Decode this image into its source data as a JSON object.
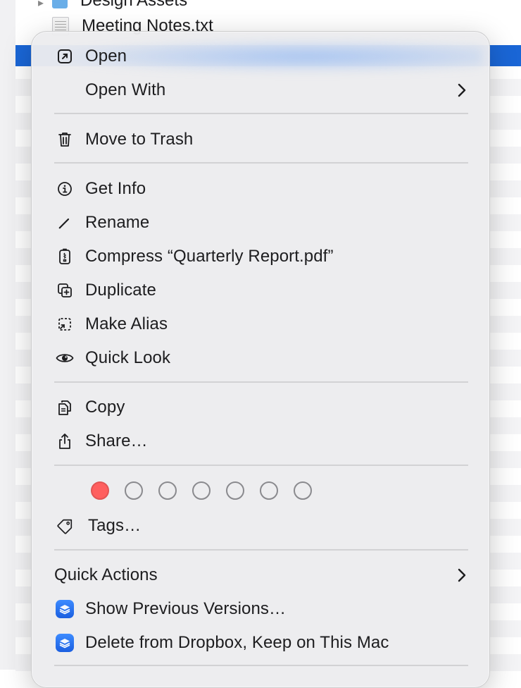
{
  "background": {
    "items": [
      {
        "name": "Design Assets",
        "kind": "folder"
      },
      {
        "name": "Meeting Notes.txt",
        "kind": "document"
      }
    ]
  },
  "menu": {
    "items": [
      {
        "id": "open",
        "label": "Open",
        "icon": "open-arrow-icon"
      },
      {
        "id": "open-with",
        "label": "Open With",
        "icon": "",
        "submenu": true
      },
      {
        "id": "move-to-trash",
        "label": "Move to Trash",
        "icon": "trash-icon"
      },
      {
        "id": "get-info",
        "label": "Get Info",
        "icon": "info-icon"
      },
      {
        "id": "rename",
        "label": "Rename",
        "icon": "pencil-icon"
      },
      {
        "id": "compress",
        "label": "Compress “Quarterly Report.pdf”",
        "icon": "archive-icon"
      },
      {
        "id": "duplicate",
        "label": "Duplicate",
        "icon": "duplicate-icon"
      },
      {
        "id": "make-alias",
        "label": "Make Alias",
        "icon": "alias-icon"
      },
      {
        "id": "quick-look",
        "label": "Quick Look",
        "icon": "eye-icon"
      },
      {
        "id": "copy",
        "label": "Copy",
        "icon": "copy-icon"
      },
      {
        "id": "share",
        "label": "Share…",
        "icon": "share-icon"
      },
      {
        "id": "tags",
        "label": "Tags…",
        "icon": "tag-icon"
      },
      {
        "id": "show-previous-versions",
        "label": "Show Previous Versions…",
        "icon": "dropbox-icon"
      },
      {
        "id": "delete-from-dropbox",
        "label": "Delete from Dropbox, Keep on This Mac",
        "icon": "dropbox-icon"
      }
    ],
    "quick_actions_label": "Quick Actions",
    "tag_colors": [
      "#ff5f5f",
      "none",
      "none",
      "none",
      "none",
      "none",
      "none"
    ]
  },
  "colors": {
    "selection": "#1a66d6",
    "menu_bg": "#ececee",
    "tag_red": "#ff5f5f"
  }
}
